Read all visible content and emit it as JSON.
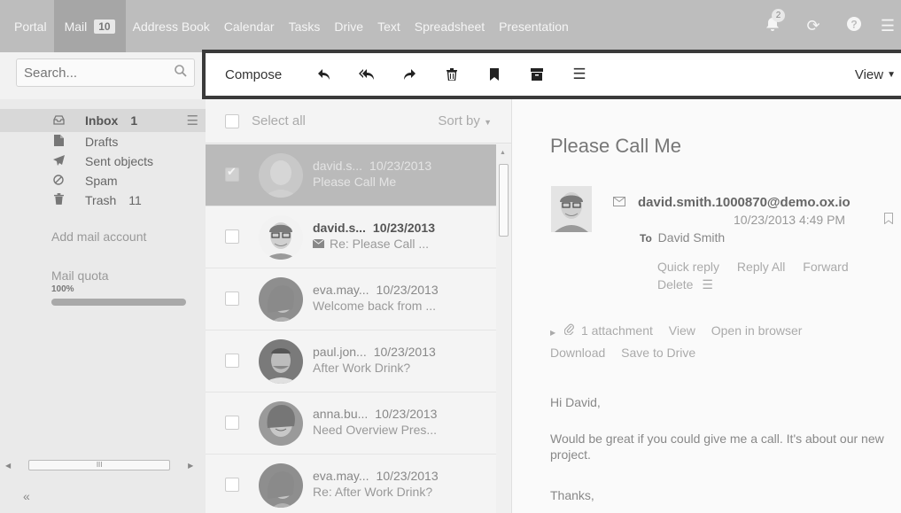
{
  "nav": {
    "items": [
      {
        "label": "Portal"
      },
      {
        "label": "Mail",
        "badge": "10"
      },
      {
        "label": "Address Book"
      },
      {
        "label": "Calendar"
      },
      {
        "label": "Tasks"
      },
      {
        "label": "Drive"
      },
      {
        "label": "Text"
      },
      {
        "label": "Spreadsheet"
      },
      {
        "label": "Presentation"
      }
    ],
    "notification_count": "2",
    "icons": [
      "bell-icon",
      "refresh-icon",
      "help-icon",
      "menu-icon"
    ]
  },
  "search": {
    "placeholder": "Search..."
  },
  "toolbar": {
    "compose_label": "Compose",
    "view_label": "View",
    "icons": [
      "reply-icon",
      "reply-all-icon",
      "forward-icon",
      "delete-icon",
      "flag-icon",
      "archive-icon",
      "more-icon"
    ]
  },
  "sidebar": {
    "folders": [
      {
        "label": "Inbox",
        "count": "1",
        "icon": "inbox-icon"
      },
      {
        "label": "Drafts",
        "count": "",
        "icon": "draft-icon"
      },
      {
        "label": "Sent objects",
        "count": "",
        "icon": "sent-icon"
      },
      {
        "label": "Spam",
        "count": "",
        "icon": "spam-icon"
      },
      {
        "label": "Trash",
        "count": "11",
        "icon": "trash-icon"
      }
    ],
    "add_account": "Add mail account",
    "quota_label": "Mail quota",
    "quota_percent": "100%",
    "quota_fraction": 1.0,
    "scroll_grip": "III",
    "collapse": "«"
  },
  "list": {
    "select_all": "Select all",
    "sort_by": "Sort by",
    "messages": [
      {
        "from": "david.s...",
        "date": "10/23/2013",
        "subject": "Please Call Me",
        "selected": true,
        "unread": false
      },
      {
        "from": "david.s...",
        "date": "10/23/2013",
        "subject": "Re: Please Call ...",
        "selected": false,
        "unread": true
      },
      {
        "from": "eva.may...",
        "date": "10/23/2013",
        "subject": "Welcome back from ...",
        "selected": false,
        "unread": false
      },
      {
        "from": "paul.jon...",
        "date": "10/23/2013",
        "subject": "After Work Drink?",
        "selected": false,
        "unread": false
      },
      {
        "from": "anna.bu...",
        "date": "10/23/2013",
        "subject": "Need Overview Pres...",
        "selected": false,
        "unread": false
      },
      {
        "from": "eva.may...",
        "date": "10/23/2013",
        "subject": "Re: After Work Drink?",
        "selected": false,
        "unread": false
      }
    ]
  },
  "detail": {
    "subject": "Please Call Me",
    "from": "david.smith.1000870@demo.ox.io",
    "date": "10/23/2013 4:49 PM",
    "to_label": "To",
    "to": "David Smith",
    "actions": [
      "Quick reply",
      "Reply All",
      "Forward"
    ],
    "delete_label": "Delete",
    "attachment": "1 attachment",
    "attachment_actions": [
      "View",
      "Open in browser"
    ],
    "attachment_actions2": [
      "Download",
      "Save to Drive"
    ],
    "body": [
      "Hi David,",
      "Would be great if you could give me a call. It's about our new project.",
      "Thanks,"
    ]
  }
}
